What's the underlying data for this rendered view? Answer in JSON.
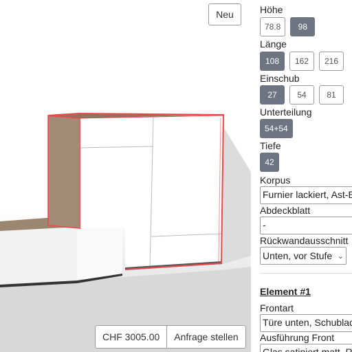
{
  "viewport": {
    "new_button": "Neu",
    "price": "CHF 3005.00",
    "request_button": "Anfrage stellen"
  },
  "panel": {
    "hoehe": {
      "label": "Höhe",
      "options": [
        "78.8",
        "98"
      ],
      "selected": "98"
    },
    "laenge": {
      "label": "Länge",
      "options": [
        "108",
        "162",
        "216"
      ],
      "selected": "108"
    },
    "einschub": {
      "label": "Einschub",
      "options": [
        "27",
        "54",
        "81"
      ],
      "selected": "27"
    },
    "unterteilung": {
      "label": "Unterteilung",
      "options": [
        "54+54"
      ],
      "selected": "54+54"
    },
    "tiefe": {
      "label": "Tiefe",
      "options": [
        "42"
      ],
      "selected": "42"
    },
    "korpus": {
      "label": "Korpus",
      "value": "Furnier lackiert, Ast-Eiche"
    },
    "abdeckblatt": {
      "label": "Abdeckblatt",
      "value": "-"
    },
    "rueckwand": {
      "label": "Rückwandausschnitt",
      "value": "Unten, vor Stufe"
    },
    "element": {
      "title": "Element #1",
      "frontart": {
        "label": "Frontart",
        "value": "Türe unten, Schublade oben"
      },
      "ausfuehrung": {
        "label": "Ausführung Front",
        "value": "Glas satiniert matt, Ref"
      }
    }
  },
  "colors": {
    "selected": "#6c7581",
    "highlight": "#e84a4a",
    "oak": "#a08c74"
  }
}
